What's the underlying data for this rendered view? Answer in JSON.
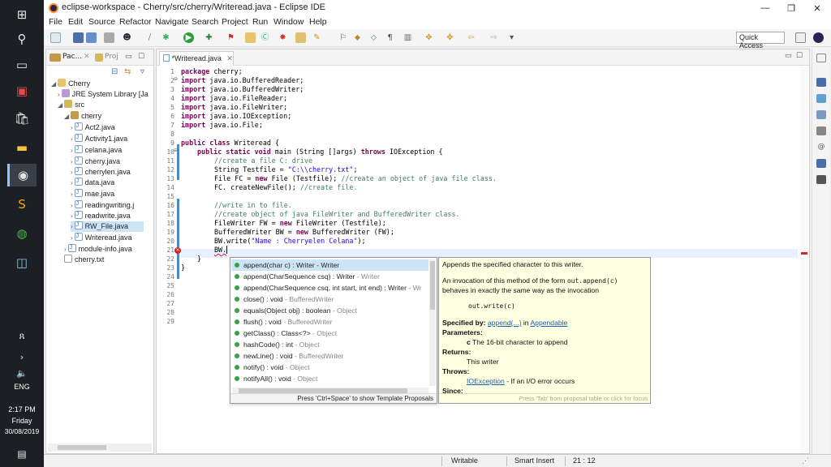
{
  "window": {
    "title": "eclipse-workspace - Cherry/src/cherry/Writeread.java - Eclipse IDE"
  },
  "menu": [
    "File",
    "Edit",
    "Source",
    "Refactor",
    "Navigate",
    "Search",
    "Project",
    "Run",
    "Window",
    "Help"
  ],
  "toolbar": {
    "quick_access": "Quick Access"
  },
  "explorer": {
    "tab_label": "Pac...",
    "tab2_label": "Proj",
    "items": [
      {
        "label": "Cherry",
        "icon": "project-icon"
      },
      {
        "label": "JRE System Library [Ja",
        "icon": "library-icon"
      },
      {
        "label": "src",
        "icon": "source-folder-icon"
      },
      {
        "label": "cherry",
        "icon": "package-icon"
      },
      {
        "label": "Act2.java",
        "icon": "java-file-icon"
      },
      {
        "label": "Activity1.java",
        "icon": "java-file-icon"
      },
      {
        "label": "celana.java",
        "icon": "java-file-icon"
      },
      {
        "label": "cherry.java",
        "icon": "java-file-icon"
      },
      {
        "label": "cherrylen.java",
        "icon": "java-file-icon"
      },
      {
        "label": "data.java",
        "icon": "java-file-icon"
      },
      {
        "label": "mae.java",
        "icon": "java-file-icon"
      },
      {
        "label": "readingwriting.j",
        "icon": "java-file-icon"
      },
      {
        "label": "readwrite.java",
        "icon": "java-file-icon"
      },
      {
        "label": "RW_File.java",
        "icon": "java-file-icon"
      },
      {
        "label": "Writeread.java",
        "icon": "java-file-icon"
      },
      {
        "label": "module-info.java",
        "icon": "java-file-icon"
      },
      {
        "label": "cherry.txt",
        "icon": "text-file-icon"
      }
    ]
  },
  "editor": {
    "tab_label": "*Writeread.java",
    "line_numbers": [
      "1",
      "2",
      "3",
      "4",
      "5",
      "6",
      "7",
      "8",
      "9",
      "10",
      "11",
      "12",
      "13",
      "14",
      "15",
      "16",
      "17",
      "18",
      "19",
      "20",
      "21",
      "22",
      "23",
      "24",
      "25",
      "26",
      "27",
      "28",
      "29"
    ],
    "code": {
      "l1_kw": "package",
      "l1_rest": " cherry;",
      "import_kw": "import",
      "l2": " java.io.BufferedReader;",
      "l3": " java.io.BufferedWriter;",
      "l4": " java.io.FileReader;",
      "l5": " java.io.FileWriter;",
      "l6": " java.io.IOException;",
      "l7": " java.io.File;",
      "l9_kw": "public class",
      "l9_rest": " Writeread {",
      "l10_kw1": "public static void",
      "l10_mid": " main (String []args) ",
      "l10_kw2": "throws",
      "l10_rest": " IOException {",
      "l11_cm": "//create a file C: drive",
      "l12_a": "String Testfile = ",
      "l12_st": "\"C:\\\\cherry.txt\"",
      "l12_b": ";",
      "l13_a": "File FC = ",
      "l13_kw": "new",
      "l13_b": " File (Testfile); ",
      "l13_cm": "//create an object of java file class.",
      "l14_a": "FC. createNewFile(); ",
      "l14_cm": "//create file.",
      "l16_cm": "//write in to file.",
      "l17_cm": "//create object of java FileWriter and BufferedWriter class.",
      "l18_a": "FileWriter FW = ",
      "l18_kw": "new",
      "l18_b": " FileWriter (Testfile);",
      "l19_a": "BufferedWriter BW = ",
      "l19_kw": "new",
      "l19_b": " BufferedWriter (FW);",
      "l20_a": "BW.write(",
      "l20_st": "\"Name : Cherryelen Celana\"",
      "l20_b": ");",
      "l21": "BW.",
      "l22": "}",
      "l23": "}"
    }
  },
  "assist": {
    "items": [
      {
        "sig": "append(char c) : Writer",
        "type": " - Writer"
      },
      {
        "sig": "append(CharSequence csq) : Writer",
        "type": " - Writer"
      },
      {
        "sig": "append(CharSequence csq, int start, int end) : Writer",
        "type": " - Wr"
      },
      {
        "sig": "close() : void",
        "type": " - BufferedWriter"
      },
      {
        "sig": "equals(Object obj) : boolean",
        "type": " - Object"
      },
      {
        "sig": "flush() : void",
        "type": " - BufferedWriter"
      },
      {
        "sig": "getClass() : Class<?>",
        "type": " - Object"
      },
      {
        "sig": "hashCode() : int",
        "type": " - Object"
      },
      {
        "sig": "newLine() : void",
        "type": " - BufferedWriter"
      },
      {
        "sig": "notify() : void",
        "type": " - Object"
      },
      {
        "sig": "notifyAll() : void",
        "type": " - Object"
      }
    ],
    "footer": "Press 'Ctrl+Space' to show Template Proposals"
  },
  "javadoc": {
    "summary": "Appends the specified character to this writer.",
    "inv1_a": "An invocation of this method of the form ",
    "inv1_code": "out.append(c)",
    "inv2": "behaves in exactly the same way as the invocation",
    "code_example": "out.write(c)",
    "specified_label": "Specified by:",
    "specified_link": "append(...)",
    "specified_in": " in ",
    "specified_class": "Appendable",
    "params_label": "Parameters:",
    "param_name": "c",
    "param_desc": " The 16-bit character to append",
    "returns_label": "Returns:",
    "returns_desc": "This writer",
    "throws_label": "Throws:",
    "throws_link": "IOException",
    "throws_desc": " - If an I/O error occurs",
    "since_label": "Since:",
    "footer": "Press 'Tab' from proposal table or click for focus"
  },
  "status": {
    "writable": "Writable",
    "insert_mode": "Smart Insert",
    "position": "21 : 12"
  },
  "taskbar": {
    "language": "ENG",
    "time": "2:17 PM",
    "day": "Friday",
    "date": "30/08/2019"
  }
}
